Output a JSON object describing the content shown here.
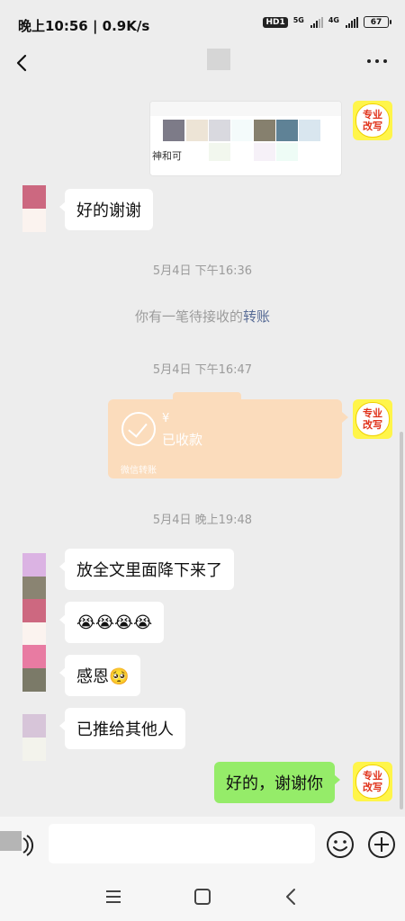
{
  "status_bar": {
    "time_speed": "晚上10:56 | 0.9K/s",
    "hd": "HD1",
    "network1": "5G",
    "network2": "4G",
    "battery": "67"
  },
  "header": {
    "back_icon": "chevron-left-icon",
    "more_icon": "more-dots-icon"
  },
  "my_avatar": {
    "line1": "专业",
    "line2": "改写"
  },
  "messages": {
    "image_caption": "神和可",
    "msg1": "好的谢谢",
    "time1": "5月4日 下午16:36",
    "system_text": "你有一笔待接收的",
    "system_link": "转账",
    "time2": "5月4日 下午16:47",
    "transfer": {
      "amount": "¥",
      "status": "已收款",
      "footer": "微信转账"
    },
    "time3": "5月4日 晚上19:48",
    "msg2": "放全文里面降下来了",
    "msg3": "😭😭😭😭",
    "msg4": "感恩🥺",
    "msg5": "已推给其他人",
    "msg6": "好的，谢谢你"
  },
  "input_bar": {
    "value": "",
    "voice_icon": "voice-icon",
    "emoji_icon": "emoji-icon",
    "plus_icon": "plus-icon"
  },
  "nav_bar": {
    "menu_icon": "menu-icon",
    "home_icon": "home-icon",
    "back_icon": "back-icon"
  },
  "colors": {
    "background": "#ededed",
    "bubble_self": "#95ec69",
    "bubble_other": "#ffffff",
    "transfer_card": "#fbdcbc",
    "link": "#576b95"
  }
}
